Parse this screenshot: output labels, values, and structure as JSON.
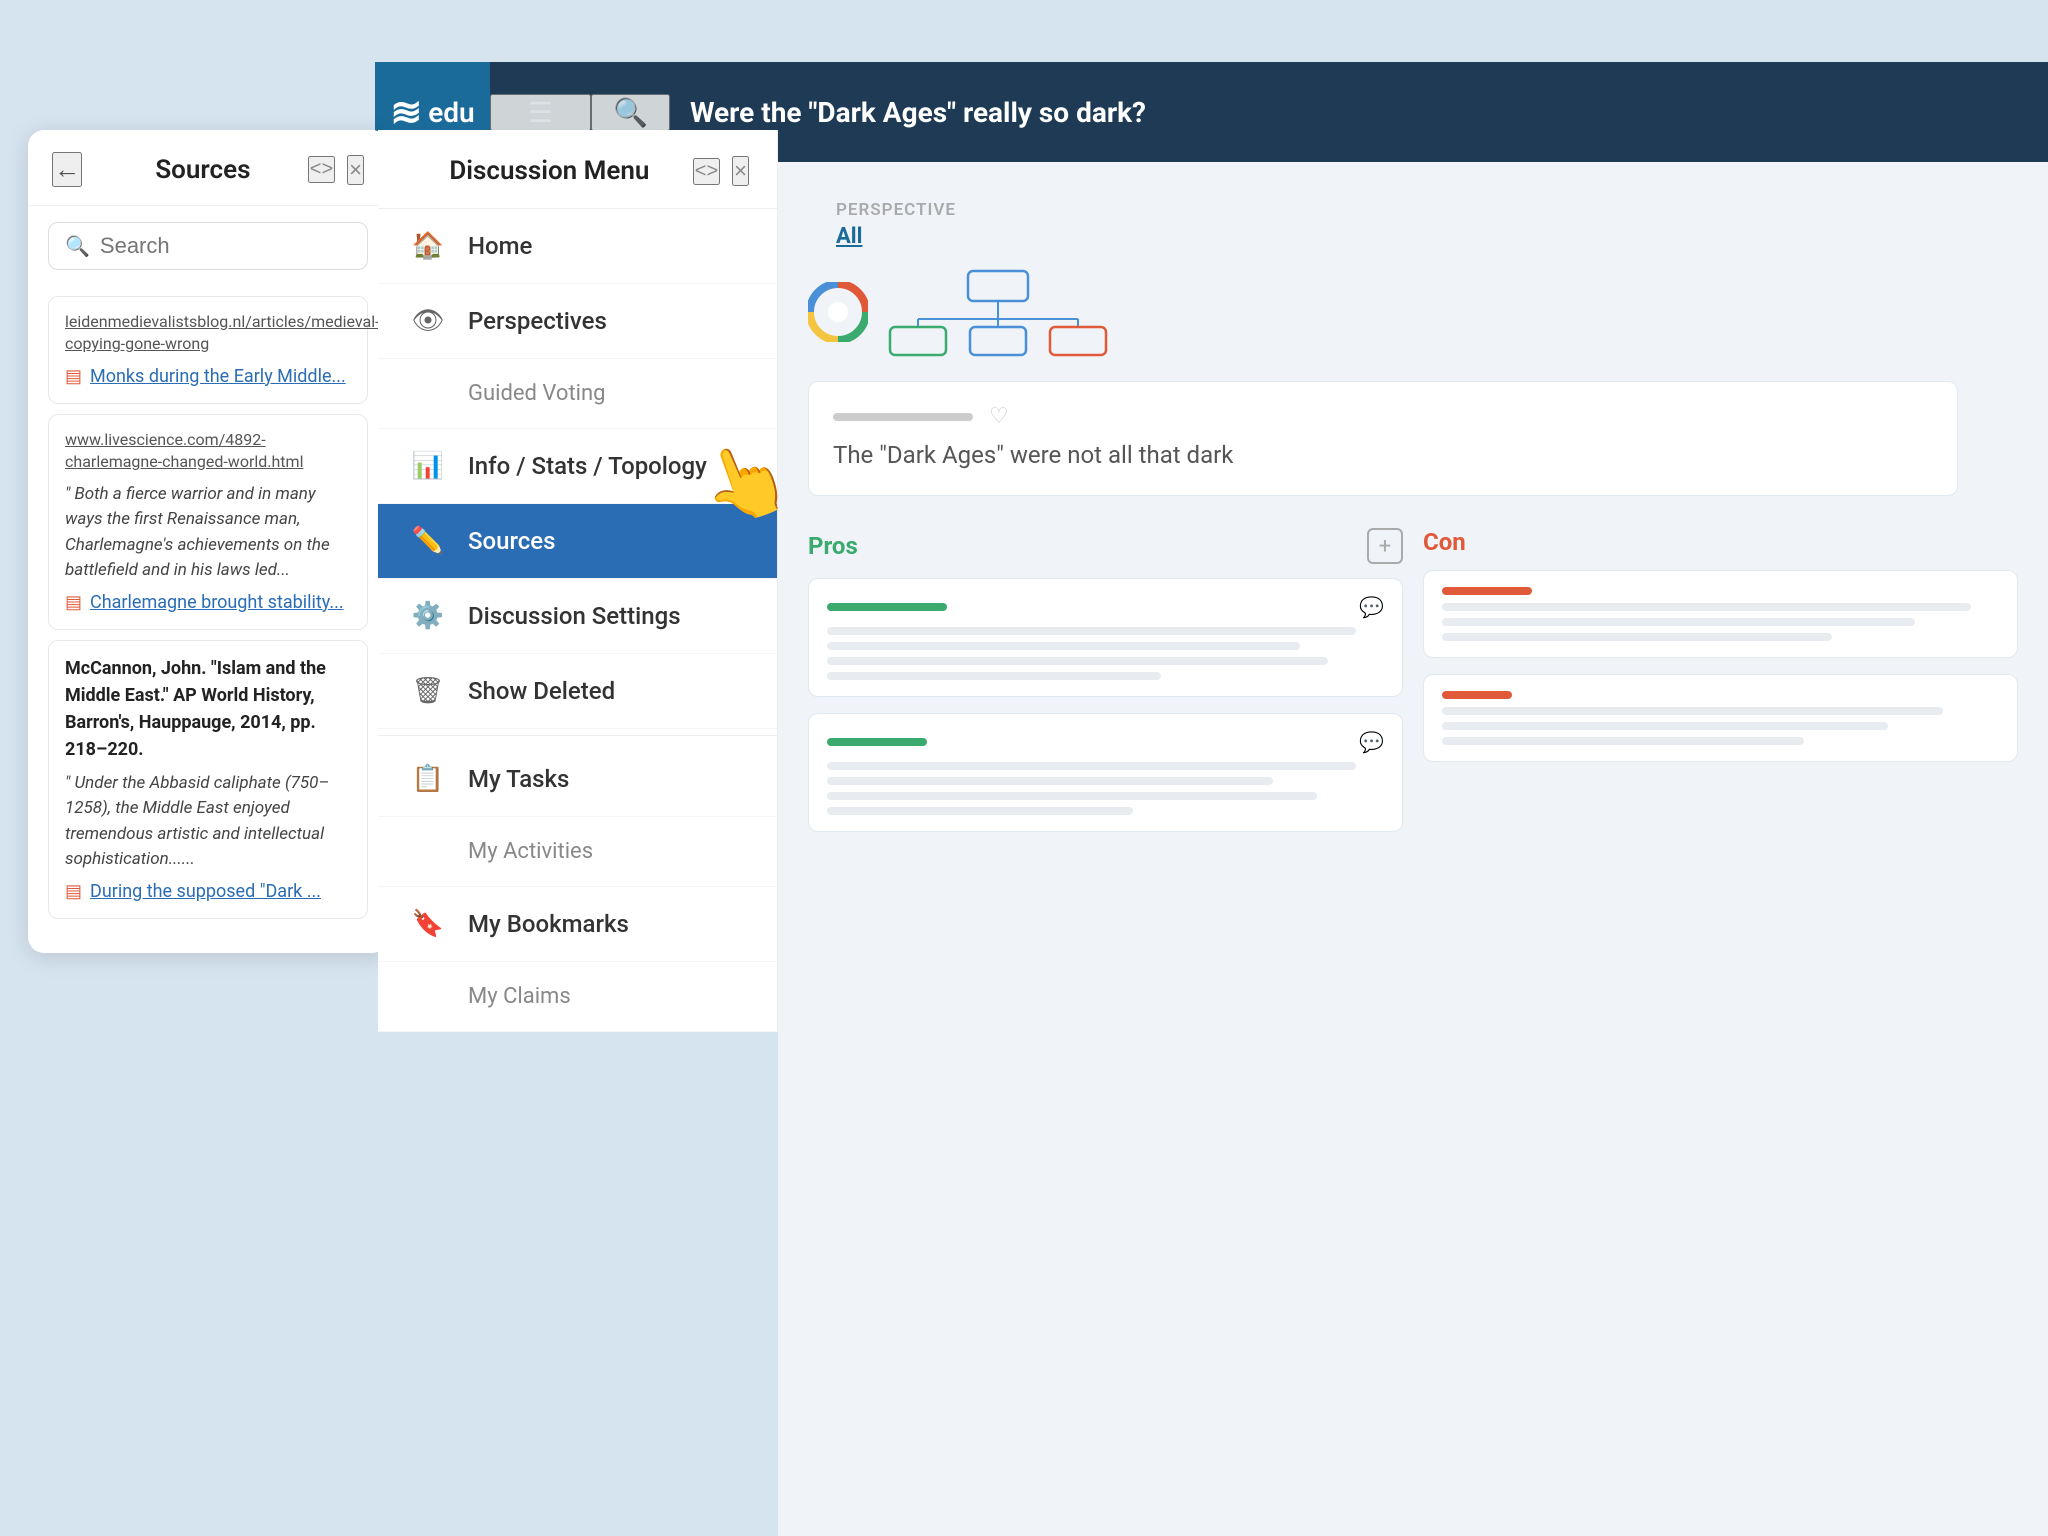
{
  "app": {
    "logo_text": "edu",
    "nav_title": "Were the \"Dark Ages\" really so dark?"
  },
  "sources_panel": {
    "title": "Sources",
    "search_placeholder": "Search",
    "back_label": "←",
    "code_label": "<>",
    "close_label": "×",
    "sources": [
      {
        "url": "leidenmedievalistsblog.nl/articles/medieval-copying-gone-wrong",
        "link_text": "Monks during the Early Middle...",
        "quote": null
      },
      {
        "url": "www.livescience.com/4892-charlemagne-changed-world.html",
        "link_text": "Charlemagne brought stability...",
        "quote": "Both a fierce warrior and in many ways the first Renaissance man, Charlemagne's achievements on the battlefield and in his laws led..."
      },
      {
        "url": null,
        "citation": "McCannon, John. \"Islam and the Middle East.\" AP World History, Barron's, Hauppauge, 2014, pp. 218–220.",
        "link_text": "During the supposed \"Dark ...",
        "quote": "Under the Abbasid caliphate (750–1258), the Middle East enjoyed tremendous artistic and intellectual sophistication......"
      }
    ]
  },
  "discussion_menu": {
    "title": "Discussion Menu",
    "code_label": "<>",
    "close_label": "×",
    "items": [
      {
        "id": "home",
        "icon": "🏠",
        "label": "Home",
        "active": false,
        "sub": false
      },
      {
        "id": "perspectives",
        "icon": "👁",
        "label": "Perspectives",
        "active": false,
        "sub": false
      },
      {
        "id": "guided-voting",
        "icon": "",
        "label": "Guided Voting",
        "active": false,
        "sub": true
      },
      {
        "id": "info-stats",
        "icon": "📊",
        "label": "Info / Stats / Topology",
        "active": false,
        "sub": false
      },
      {
        "id": "sources",
        "icon": "✏️",
        "label": "Sources",
        "active": true,
        "sub": false
      },
      {
        "id": "discussion-settings",
        "icon": "⚙️",
        "label": "Discussion Settings",
        "active": false,
        "sub": false
      },
      {
        "id": "show-deleted",
        "icon": "🗑",
        "label": "Show Deleted",
        "active": false,
        "sub": false
      },
      {
        "id": "my-tasks",
        "icon": "📋",
        "label": "My Tasks",
        "active": false,
        "sub": false
      },
      {
        "id": "my-activities",
        "icon": "",
        "label": "My Activities",
        "active": false,
        "sub": true
      },
      {
        "id": "my-bookmarks",
        "icon": "🔖",
        "label": "My Bookmarks",
        "active": false,
        "sub": false
      },
      {
        "id": "my-claims",
        "icon": "",
        "label": "My Claims",
        "active": false,
        "sub": true
      }
    ]
  },
  "main_area": {
    "perspective_label": "PERSPECTIVE",
    "perspective_value": "All",
    "discussion_text": "The \"Dark Ages\" were not all that dark",
    "pros_label": "Pros",
    "cons_label": "Con",
    "add_label": "+"
  }
}
